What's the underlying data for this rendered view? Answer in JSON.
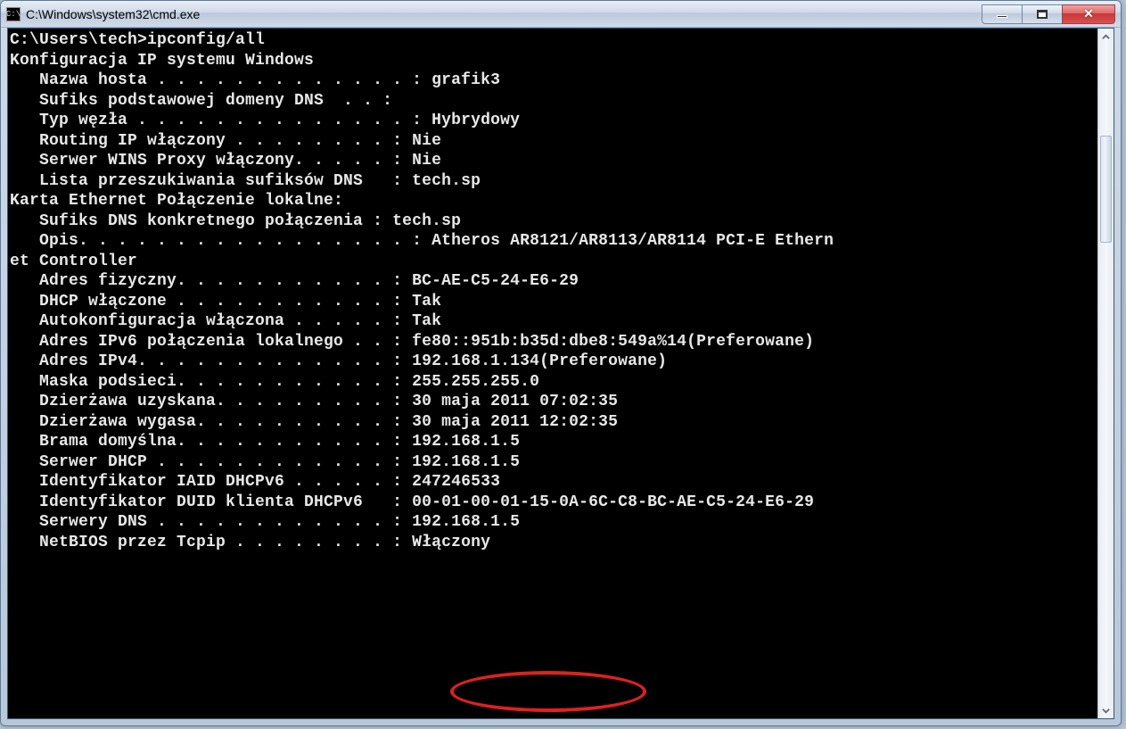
{
  "window": {
    "title": "C:\\Windows\\system32\\cmd.exe",
    "icon_text": "C:\\"
  },
  "console": {
    "prompt_line": "C:\\Users\\tech>ipconfig/all",
    "blank": "",
    "header1": "Konfiguracja IP systemu Windows",
    "hn_label": "   Nazwa hosta . . . . . . . . . . . . . : ",
    "hn_value": "grafik3",
    "suf_label": "   Sufiks podstawowej domeny DNS  . . :",
    "nt_label": "   Typ węzła . . . . . . . . . . . . . . : ",
    "nt_value": "Hybrydowy",
    "rip_label": "   Routing IP włączony . . . . . . . . : ",
    "rip_value": "Nie",
    "wins_label": "   Serwer WINS Proxy włączony. . . . . : ",
    "wins_value": "Nie",
    "dsl_label": "   Lista przeszukiwania sufiksów DNS   : ",
    "dsl_value": "tech.sp",
    "header2": "Karta Ethernet Połączenie lokalne:",
    "cdns_label": "   Sufiks DNS konkretnego połączenia : ",
    "cdns_value": "tech.sp",
    "desc_label": "   Opis. . . . . . . . . . . . . . . . . : ",
    "desc_value": "Atheros AR8121/AR8113/AR8114 PCI-E Ethern",
    "desc_cont": "et Controller",
    "phy_label": "   Adres fizyczny. . . . . . . . . . . : ",
    "phy_value": "BC-AE-C5-24-E6-29",
    "dhcp_label": "   DHCP włączone . . . . . . . . . . . : ",
    "dhcp_value": "Tak",
    "auto_label": "   Autokonfiguracja włączona . . . . . : ",
    "auto_value": "Tak",
    "ipv6_label": "   Adres IPv6 połączenia lokalnego . . : ",
    "ipv6_value": "fe80::951b:b35d:dbe8:549a%14(Preferowane)",
    "ipv4_label": "   Adres IPv4. . . . . . . . . . . . . : ",
    "ipv4_value": "192.168.1.134(Preferowane)",
    "mask_label": "   Maska podsieci. . . . . . . . . . . : ",
    "mask_value": "255.255.255.0",
    "lobt_label": "   Dzierżawa uzyskana. . . . . . . . . : ",
    "lobt_value": "30 maja 2011 07:02:35",
    "lexp_label": "   Dzierżawa wygasa. . . . . . . . . . : ",
    "lexp_value": "30 maja 2011 12:02:35",
    "gw_label": "   Brama domyślna. . . . . . . . . . . : ",
    "gw_value": "192.168.1.5",
    "dsrv_label": "   Serwer DHCP . . . . . . . . . . . . : ",
    "dsrv_value": "192.168.1.5",
    "iaid_label": "   Identyfikator IAID DHCPv6 . . . . . : ",
    "iaid_value": "247246533",
    "duid_label": "   Identyfikator DUID klienta DHCPv6   : ",
    "duid_value": "00-01-00-01-15-0A-6C-C8-BC-AE-C5-24-E6-29",
    "dns_label": "   Serwery DNS . . . . . . . . . . . . : ",
    "dns_value": "192.168.1.5",
    "nb_label": "   NetBIOS przez Tcpip . . . . . . . . : ",
    "nb_value": "Włączony"
  }
}
